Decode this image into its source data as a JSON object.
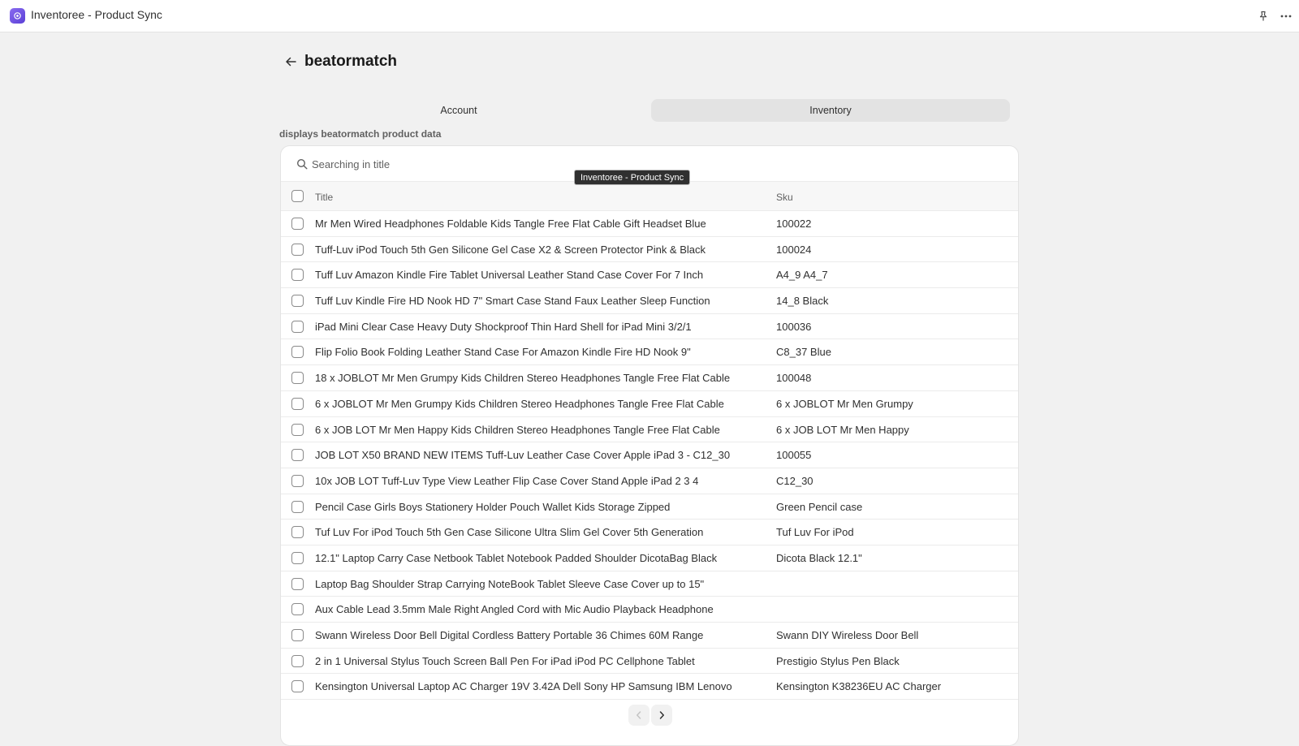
{
  "app": {
    "title": "Inventoree - Product Sync",
    "icons": [
      "app-logo-icon",
      "pin-icon",
      "more-icon"
    ]
  },
  "page": {
    "title": "beatormatch",
    "description": "displays beatormatch product data"
  },
  "tabs": [
    {
      "label": "Account",
      "selected": false
    },
    {
      "label": "Inventory",
      "selected": true
    }
  ],
  "search": {
    "placeholder": "Searching in title",
    "value": ""
  },
  "tooltip": "Inventoree - Product Sync",
  "table": {
    "columns": [
      "Title",
      "Sku"
    ],
    "rows": [
      {
        "title": "Mr Men Wired Headphones Foldable Kids Tangle Free Flat Cable Gift Headset Blue",
        "sku": "100022"
      },
      {
        "title": "Tuff-Luv iPod Touch 5th Gen Silicone Gel Case X2 & Screen Protector Pink & Black",
        "sku": "100024"
      },
      {
        "title": "Tuff Luv Amazon Kindle Fire Tablet Universal Leather Stand Case Cover For 7 Inch",
        "sku": "A4_9 A4_7"
      },
      {
        "title": "Tuff Luv Kindle Fire HD Nook HD 7\" Smart Case Stand Faux Leather Sleep Function",
        "sku": "14_8 Black"
      },
      {
        "title": "iPad Mini Clear Case Heavy Duty Shockproof Thin Hard Shell for iPad Mini 3/2/1",
        "sku": "100036"
      },
      {
        "title": "Flip Folio Book Folding Leather Stand Case For Amazon Kindle Fire HD Nook 9\"",
        "sku": "C8_37 Blue"
      },
      {
        "title": "18 x JOBLOT Mr Men Grumpy Kids Children Stereo Headphones Tangle Free Flat Cable",
        "sku": "100048"
      },
      {
        "title": "6 x JOBLOT Mr Men Grumpy Kids Children Stereo Headphones Tangle Free Flat Cable",
        "sku": "6 x JOBLOT Mr Men Grumpy"
      },
      {
        "title": "6 x JOB LOT Mr Men Happy Kids Children Stereo Headphones Tangle Free Flat Cable",
        "sku": "6 x JOB LOT Mr Men Happy"
      },
      {
        "title": "JOB LOT X50 BRAND NEW ITEMS Tuff-Luv Leather Case Cover Apple iPad 3 - C12_30",
        "sku": "100055"
      },
      {
        "title": "10x JOB LOT Tuff-Luv Type View Leather Flip Case Cover Stand Apple iPad 2 3 4",
        "sku": "C12_30"
      },
      {
        "title": "Pencil Case Girls Boys Stationery Holder Pouch Wallet Kids Storage Zipped",
        "sku": "Green Pencil case"
      },
      {
        "title": "Tuf Luv For iPod Touch 5th Gen Case Silicone Ultra Slim Gel Cover 5th Generation",
        "sku": "Tuf Luv For iPod"
      },
      {
        "title": "12.1\" Laptop Carry Case Netbook Tablet Notebook Padded Shoulder DicotaBag Black",
        "sku": "Dicota Black 12.1\""
      },
      {
        "title": "Laptop Bag Shoulder Strap Carrying NoteBook Tablet Sleeve Case Cover up to 15\"",
        "sku": ""
      },
      {
        "title": "Aux Cable Lead 3.5mm Male Right Angled Cord with Mic Audio Playback Headphone",
        "sku": ""
      },
      {
        "title": "Swann Wireless Door Bell Digital Cordless Battery Portable 36 Chimes 60M Range",
        "sku": "Swann DIY Wireless Door Bell"
      },
      {
        "title": "2 in 1 Universal Stylus Touch Screen Ball Pen For iPad iPod PC Cellphone Tablet",
        "sku": "Prestigio Stylus Pen Black"
      },
      {
        "title": "Kensington Universal Laptop AC Charger 19V 3.42A Dell Sony HP Samsung IBM Lenovo",
        "sku": "Kensington K38236EU AC Charger"
      }
    ]
  },
  "pagination": {
    "prev_icon": "chevron-left-icon",
    "next_icon": "chevron-right-icon",
    "prev_disabled": true
  },
  "colors": {
    "brand": "#6c4fe0",
    "background": "#f1f1f1",
    "tab_selected": "#e3e3e3"
  }
}
